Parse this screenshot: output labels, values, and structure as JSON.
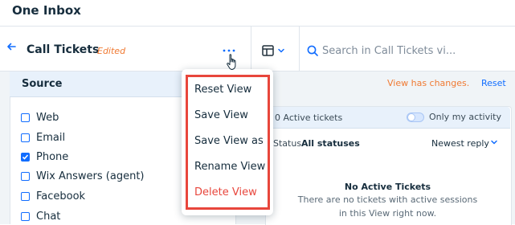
{
  "app": {
    "title": "One Inbox"
  },
  "header": {
    "view_title": "Call Tickets",
    "edited_badge": "Edited",
    "more_label": "···",
    "search_placeholder": "Search in Call Tickets vi..."
  },
  "source_filter": {
    "title": "Source",
    "options": [
      {
        "label": "Web",
        "checked": false
      },
      {
        "label": "Email",
        "checked": false
      },
      {
        "label": "Phone",
        "checked": true
      },
      {
        "label": "Wix Answers (agent)",
        "checked": false
      },
      {
        "label": "Facebook",
        "checked": false
      },
      {
        "label": "Chat",
        "checked": false
      }
    ]
  },
  "view_notice": {
    "message": "View has changes.",
    "reset_label": "Reset"
  },
  "tickets": {
    "active_count": "0 Active tickets",
    "only_my_activity_label": "Only my activity",
    "only_my_activity_on": false,
    "status_label": "Status",
    "status_value": "All statuses",
    "sort_value": "Newest reply",
    "empty_title": "No Active Tickets",
    "empty_line1": "There are no tickets with active sessions",
    "empty_line2": "in this View right now."
  },
  "view_menu": {
    "items": [
      {
        "label": "Reset View"
      },
      {
        "label": "Save View"
      },
      {
        "label": "Save View as"
      },
      {
        "label": "Rename View"
      },
      {
        "label": "Delete View"
      }
    ]
  },
  "colors": {
    "accent": "#116dff",
    "warning": "#f07a33",
    "danger": "#e8463c",
    "panel_header": "#e8f1fb"
  }
}
